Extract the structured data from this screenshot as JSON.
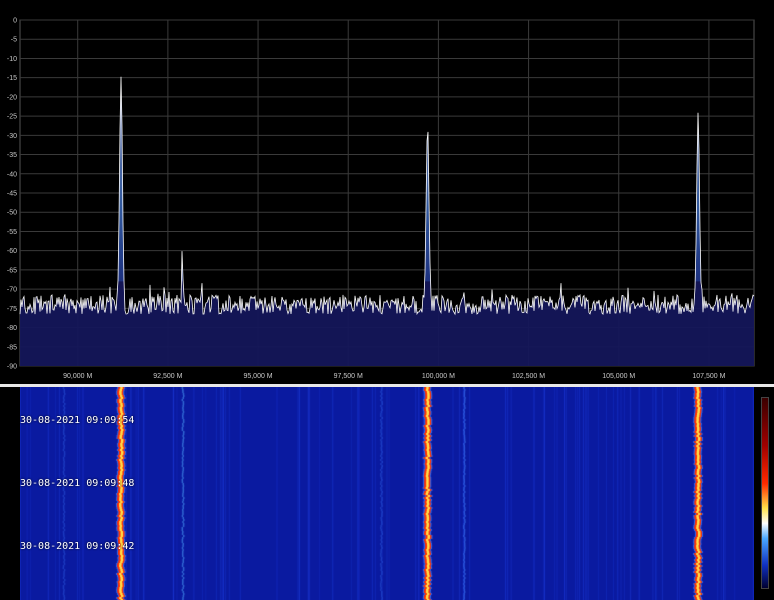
{
  "spectrum": {
    "y_ticks": [
      "0",
      "-5",
      "-10",
      "-15",
      "-20",
      "-25",
      "-30",
      "-35",
      "-40",
      "-45",
      "-50",
      "-55",
      "-60",
      "-65",
      "-70",
      "-75",
      "-80",
      "-85",
      "-90"
    ],
    "x_ticks": [
      "90,000 M",
      "92,500 M",
      "95,000 M",
      "97,500 M",
      "100,000 M",
      "102,500 M",
      "105,000 M",
      "107,500 M"
    ],
    "y_range": [
      -90,
      0
    ],
    "noise_floor_db": -74,
    "peaks": [
      {
        "freq_mhz": 91.2,
        "level_db": -14
      },
      {
        "freq_mhz": 92.9,
        "level_db": -57
      },
      {
        "freq_mhz": 99.7,
        "level_db": -27
      },
      {
        "freq_mhz": 100.7,
        "level_db": -70
      },
      {
        "freq_mhz": 107.2,
        "level_db": -25
      }
    ],
    "colors": {
      "trace": "#ffffff",
      "fill": "#14165a",
      "grid": "#3a3a3a",
      "peak_fill": "#4a90d9"
    }
  },
  "waterfall": {
    "timestamps": [
      "30-08-2021 09:09:54",
      "30-08-2021 09:09:48",
      "30-08-2021 09:09:42"
    ],
    "colors": {
      "background": "#0a1aa0",
      "hot": "#ff2a00",
      "warm": "#ffe14a"
    }
  }
}
